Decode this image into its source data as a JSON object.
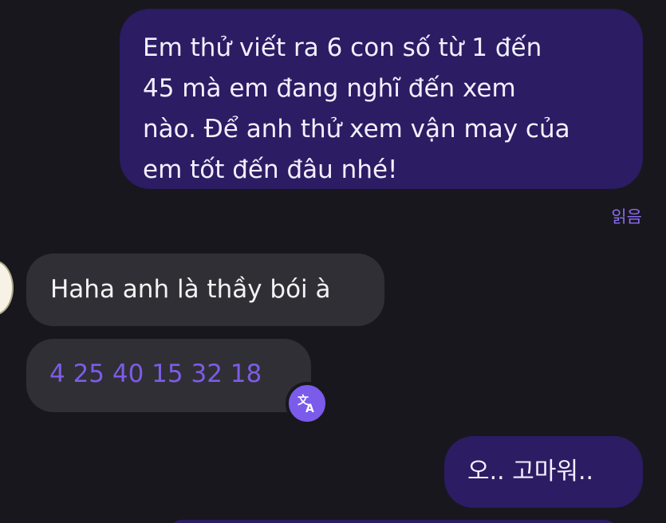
{
  "messages": [
    {
      "direction": "sent",
      "text": "Em thử viết ra 6 con số từ 1 đến 45 mà em đang nghĩ đến xem nào. Để anh thử xem vận may của em tốt đến đâu nhé!",
      "lines": [
        "Em thử viết ra 6 con số từ 1 đến",
        "45 mà em đang nghĩ đến xem",
        "nào. Để anh thử xem vận may của",
        "em tốt đến đâu nhé!"
      ],
      "status": "읽음"
    },
    {
      "direction": "received",
      "text": "Haha anh là thầy bói à"
    },
    {
      "direction": "received",
      "text": "4 25 40 15 32 18",
      "translate_icon": "translate-icon"
    },
    {
      "direction": "sent",
      "text": "오.. 고마워.."
    }
  ],
  "colors": {
    "background": "#18171d",
    "sent_bubble": "#2b1c63",
    "received_bubble": "#302f35",
    "accent": "#7a5bea",
    "read_receipt": "#8a6df0"
  }
}
